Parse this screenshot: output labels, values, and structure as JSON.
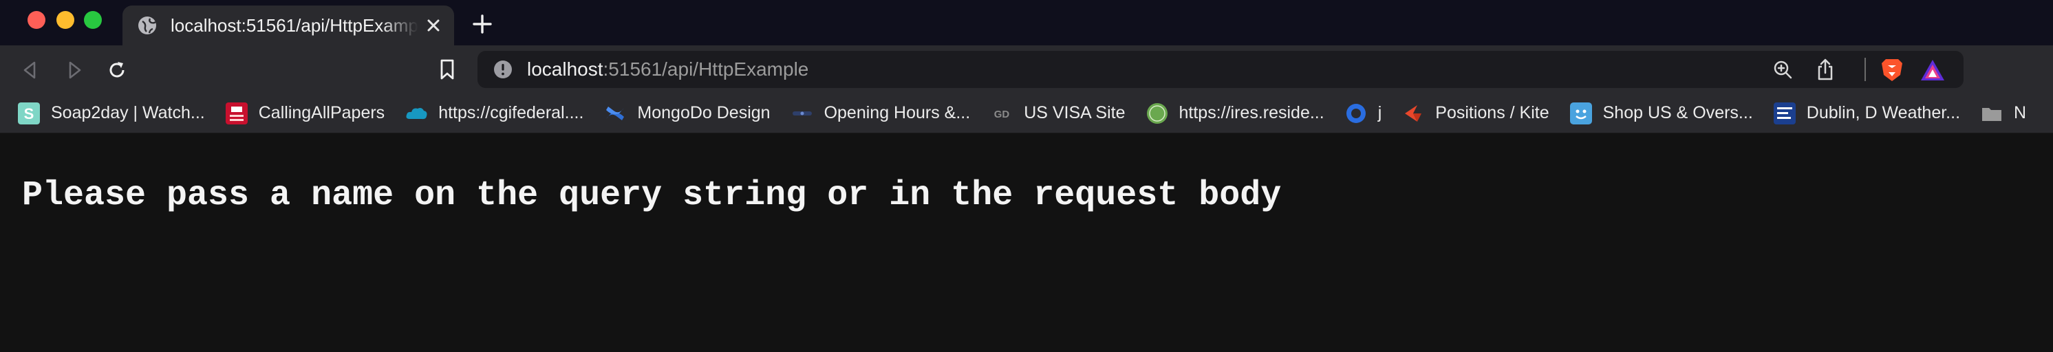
{
  "window": {
    "buttons": [
      "close",
      "minimize",
      "zoom"
    ]
  },
  "tab": {
    "title": "localhost:51561/api/HttpExample",
    "icon": "globe-icon"
  },
  "toolbar": {
    "url_host": "localhost",
    "url_rest": ":51561/api/HttpExample",
    "icons": [
      "back-icon",
      "forward-icon",
      "reload-icon",
      "bookmark-icon",
      "site-info-icon",
      "zoom-icon",
      "share-icon",
      "brave-shields-icon",
      "brave-rewards-icon"
    ]
  },
  "bookmarks": [
    {
      "label": "Soap2day | Watch...",
      "icon": "soap2day-icon",
      "color": "#7fd6c6"
    },
    {
      "label": "CallingAllPapers",
      "icon": "callingallpapers-icon",
      "color": "#c8102e"
    },
    {
      "label": "https://cgifederal....",
      "icon": "salesforce-cloud-icon",
      "color": "#1798c1"
    },
    {
      "label": "MongoDo Design",
      "icon": "confluence-icon",
      "color": "#2f6fd6"
    },
    {
      "label": "Opening Hours &...",
      "icon": "link-icon",
      "color": "#3a5a9a"
    },
    {
      "label": "US VISA Site",
      "icon": "gd-icon",
      "color": "#8a8a8a"
    },
    {
      "label": "https://ires.reside...",
      "icon": "ires-icon",
      "color": "#6aa84f"
    },
    {
      "label": "j",
      "icon": "circle-icon",
      "color": "#2a6de0"
    },
    {
      "label": "Positions / Kite",
      "icon": "kite-icon",
      "color": "#e8472b"
    },
    {
      "label": "Shop US & Overs...",
      "icon": "shop-icon",
      "color": "#4aa3df"
    },
    {
      "label": "Dublin, D Weather...",
      "icon": "weather-channel-icon",
      "color": "#1b3f8f"
    },
    {
      "label": "N",
      "icon": "folder-icon",
      "color": "#9a9a9a"
    }
  ],
  "page": {
    "message": "Please pass a name on the query string or in the request body"
  },
  "colors": {
    "tabstrip_bg": "#0f0f1c",
    "toolbar_bg": "#2a2a2e",
    "page_bg": "#121212"
  }
}
